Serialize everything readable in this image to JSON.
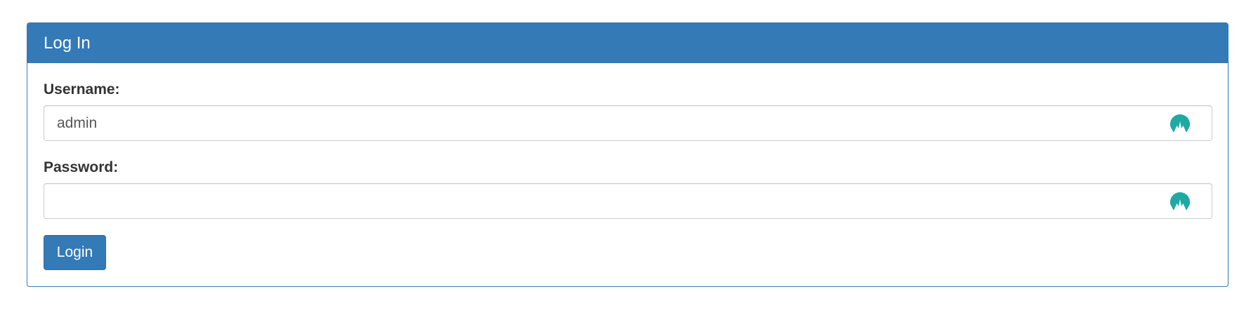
{
  "panel": {
    "title": "Log In"
  },
  "form": {
    "username_label": "Username:",
    "username_value": "admin",
    "password_label": "Password:",
    "password_value": "",
    "login_label": "Login"
  },
  "icons": {
    "password_manager": "nordpass-icon"
  },
  "colors": {
    "primary": "#337ab7",
    "icon_teal": "#1fa9a4"
  }
}
